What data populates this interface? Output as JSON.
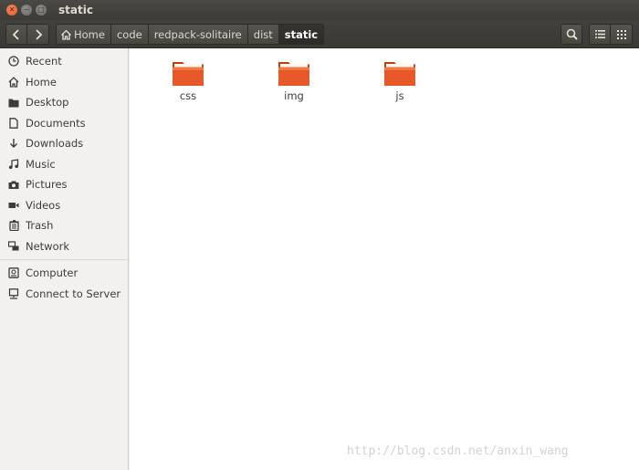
{
  "window": {
    "title": "static"
  },
  "breadcrumb": [
    {
      "label": "Home",
      "icon": "home-icon"
    },
    {
      "label": "code"
    },
    {
      "label": "redpack-solitaire"
    },
    {
      "label": "dist"
    },
    {
      "label": "static",
      "active": true
    }
  ],
  "sidebar": {
    "places": [
      {
        "label": "Recent",
        "icon": "clock-icon"
      },
      {
        "label": "Home",
        "icon": "home-icon"
      },
      {
        "label": "Desktop",
        "icon": "folder-icon"
      },
      {
        "label": "Documents",
        "icon": "document-icon"
      },
      {
        "label": "Downloads",
        "icon": "download-icon"
      },
      {
        "label": "Music",
        "icon": "music-icon"
      },
      {
        "label": "Pictures",
        "icon": "camera-icon"
      },
      {
        "label": "Videos",
        "icon": "video-icon"
      },
      {
        "label": "Trash",
        "icon": "trash-icon"
      },
      {
        "label": "Network",
        "icon": "network-icon"
      }
    ],
    "devices": [
      {
        "label": "Computer",
        "icon": "computer-icon"
      },
      {
        "label": "Connect to Server",
        "icon": "server-icon"
      }
    ]
  },
  "files": [
    {
      "name": "css",
      "type": "folder"
    },
    {
      "name": "img",
      "type": "folder"
    },
    {
      "name": "js",
      "type": "folder"
    }
  ],
  "watermark": "http://blog.csdn.net/anxin_wang",
  "colors": {
    "folder": "#e8592a",
    "titlebar": "#3c3b37",
    "close_button": "#e35b26"
  }
}
